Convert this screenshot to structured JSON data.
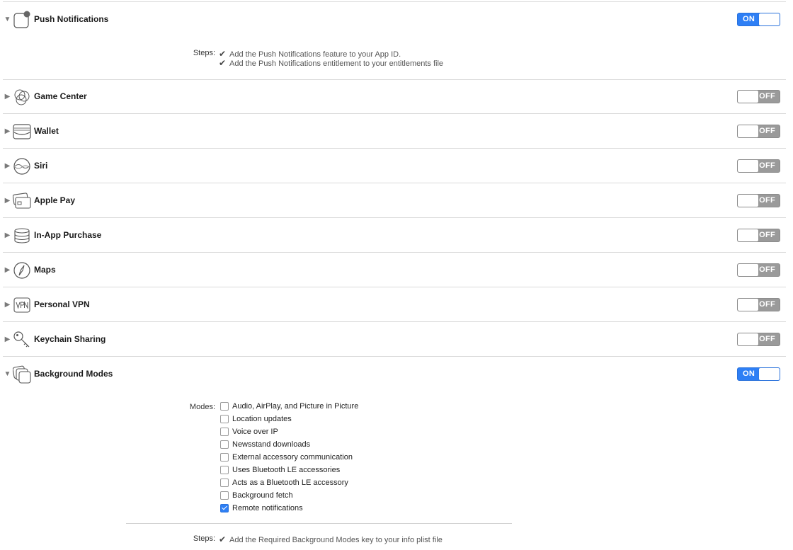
{
  "capabilities": [
    {
      "title": "Push Notifications",
      "icon": "push-notifications-icon",
      "state": "ON",
      "expanded": true
    },
    {
      "title": "Game Center",
      "icon": "game-center-icon",
      "state": "OFF",
      "expanded": false
    },
    {
      "title": "Wallet",
      "icon": "wallet-icon",
      "state": "OFF",
      "expanded": false
    },
    {
      "title": "Siri",
      "icon": "siri-icon",
      "state": "OFF",
      "expanded": false
    },
    {
      "title": "Apple Pay",
      "icon": "apple-pay-icon",
      "state": "OFF",
      "expanded": false
    },
    {
      "title": "In-App Purchase",
      "icon": "in-app-purchase-icon",
      "state": "OFF",
      "expanded": false
    },
    {
      "title": "Maps",
      "icon": "maps-icon",
      "state": "OFF",
      "expanded": false
    },
    {
      "title": "Personal VPN",
      "icon": "vpn-icon",
      "state": "OFF",
      "expanded": false
    },
    {
      "title": "Keychain Sharing",
      "icon": "keychain-icon",
      "state": "OFF",
      "expanded": false
    },
    {
      "title": "Background Modes",
      "icon": "background-modes-icon",
      "state": "ON",
      "expanded": true
    }
  ],
  "push": {
    "steps_label": "Steps:",
    "steps": [
      "Add the Push Notifications feature to your App ID.",
      "Add the Push Notifications entitlement to your entitlements file"
    ]
  },
  "background": {
    "modes_label": "Modes:",
    "modes": [
      {
        "label": "Audio, AirPlay, and Picture in Picture",
        "checked": false
      },
      {
        "label": "Location updates",
        "checked": false
      },
      {
        "label": "Voice over IP",
        "checked": false
      },
      {
        "label": "Newsstand downloads",
        "checked": false
      },
      {
        "label": "External accessory communication",
        "checked": false
      },
      {
        "label": "Uses Bluetooth LE accessories",
        "checked": false
      },
      {
        "label": "Acts as a Bluetooth LE accessory",
        "checked": false
      },
      {
        "label": "Background fetch",
        "checked": false
      },
      {
        "label": "Remote notifications",
        "checked": true
      }
    ],
    "steps_label": "Steps:",
    "steps": [
      "Add the Required Background Modes key to your info plist file"
    ]
  },
  "colors": {
    "toggle_on": "#2e7ff5",
    "toggle_off": "#9a9a9a",
    "divider": "#d9d9d9"
  },
  "glyphs": {
    "expanded": "▼",
    "collapsed": "▶",
    "checkmark": "✔"
  }
}
